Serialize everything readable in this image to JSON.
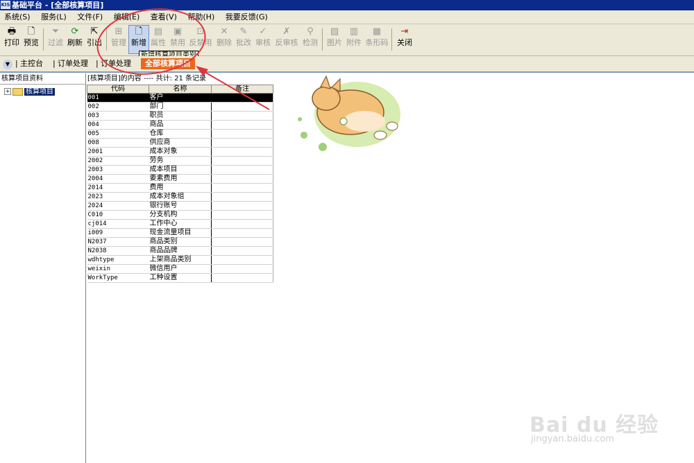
{
  "window": {
    "logo": "KIS",
    "title": "基础平台 - [全部核算项目]"
  },
  "menu": [
    "系统(S)",
    "服务(L)",
    "文件(F)",
    "编辑(E)",
    "查看(V)",
    "帮助(H)",
    "我要反馈(G)"
  ],
  "toolbar": {
    "print": "打印",
    "preview": "预览",
    "filter": "过滤",
    "refresh": "刷新",
    "import": "引出",
    "manage": "管理",
    "new": "新增",
    "property": "属性",
    "disable": "禁用",
    "enable": "反禁用",
    "delete": "删除",
    "batch_edit": "批改",
    "audit": "审核",
    "unaudit": "反审核",
    "check": "检测",
    "image": "图片",
    "attachment": "附件",
    "barcode": "条形码",
    "close": "关闭"
  },
  "tooltip": "新增核算项目类别",
  "tabs": {
    "main": "主控台",
    "order1": "订单处理",
    "order2": "订单处理",
    "current": "全部核算项目"
  },
  "left_pane": {
    "header": "核算项目资料",
    "tree_root": "核算项目",
    "expand": "+"
  },
  "content": {
    "header": "[核算项目]的内容 ---- 共计: 21 条记录"
  },
  "grid": {
    "columns": [
      "代码",
      "名称",
      "备注"
    ],
    "rows": [
      {
        "code": "001",
        "name": "客户",
        "note": ""
      },
      {
        "code": "002",
        "name": "部门",
        "note": ""
      },
      {
        "code": "003",
        "name": "职员",
        "note": ""
      },
      {
        "code": "004",
        "name": "商品",
        "note": ""
      },
      {
        "code": "005",
        "name": "仓库",
        "note": ""
      },
      {
        "code": "008",
        "name": "供应商",
        "note": ""
      },
      {
        "code": "2001",
        "name": "成本对象",
        "note": ""
      },
      {
        "code": "2002",
        "name": "劳务",
        "note": ""
      },
      {
        "code": "2003",
        "name": "成本项目",
        "note": ""
      },
      {
        "code": "2004",
        "name": "要素费用",
        "note": ""
      },
      {
        "code": "2014",
        "name": "费用",
        "note": ""
      },
      {
        "code": "2023",
        "name": "成本对象组",
        "note": ""
      },
      {
        "code": "2024",
        "name": "银行账号",
        "note": ""
      },
      {
        "code": "C010",
        "name": "分支机构",
        "note": ""
      },
      {
        "code": "cj014",
        "name": "工作中心",
        "note": ""
      },
      {
        "code": "i009",
        "name": "现金流量项目",
        "note": ""
      },
      {
        "code": "N2037",
        "name": "商品类别",
        "note": ""
      },
      {
        "code": "N2038",
        "name": "商品品牌",
        "note": ""
      },
      {
        "code": "wdhtype",
        "name": "上架商品类别",
        "note": ""
      },
      {
        "code": "weixin",
        "name": "微信用户",
        "note": ""
      },
      {
        "code": "WorkType",
        "name": "工种设置",
        "note": ""
      }
    ]
  },
  "watermark": {
    "brand": "Bai du 经验",
    "url": "jingyan.baidu.com"
  },
  "colors": {
    "titlebar": "#0a2a8c",
    "annotation": "#e0343a",
    "active_tab": "#e8691f",
    "selection": "#000000"
  }
}
